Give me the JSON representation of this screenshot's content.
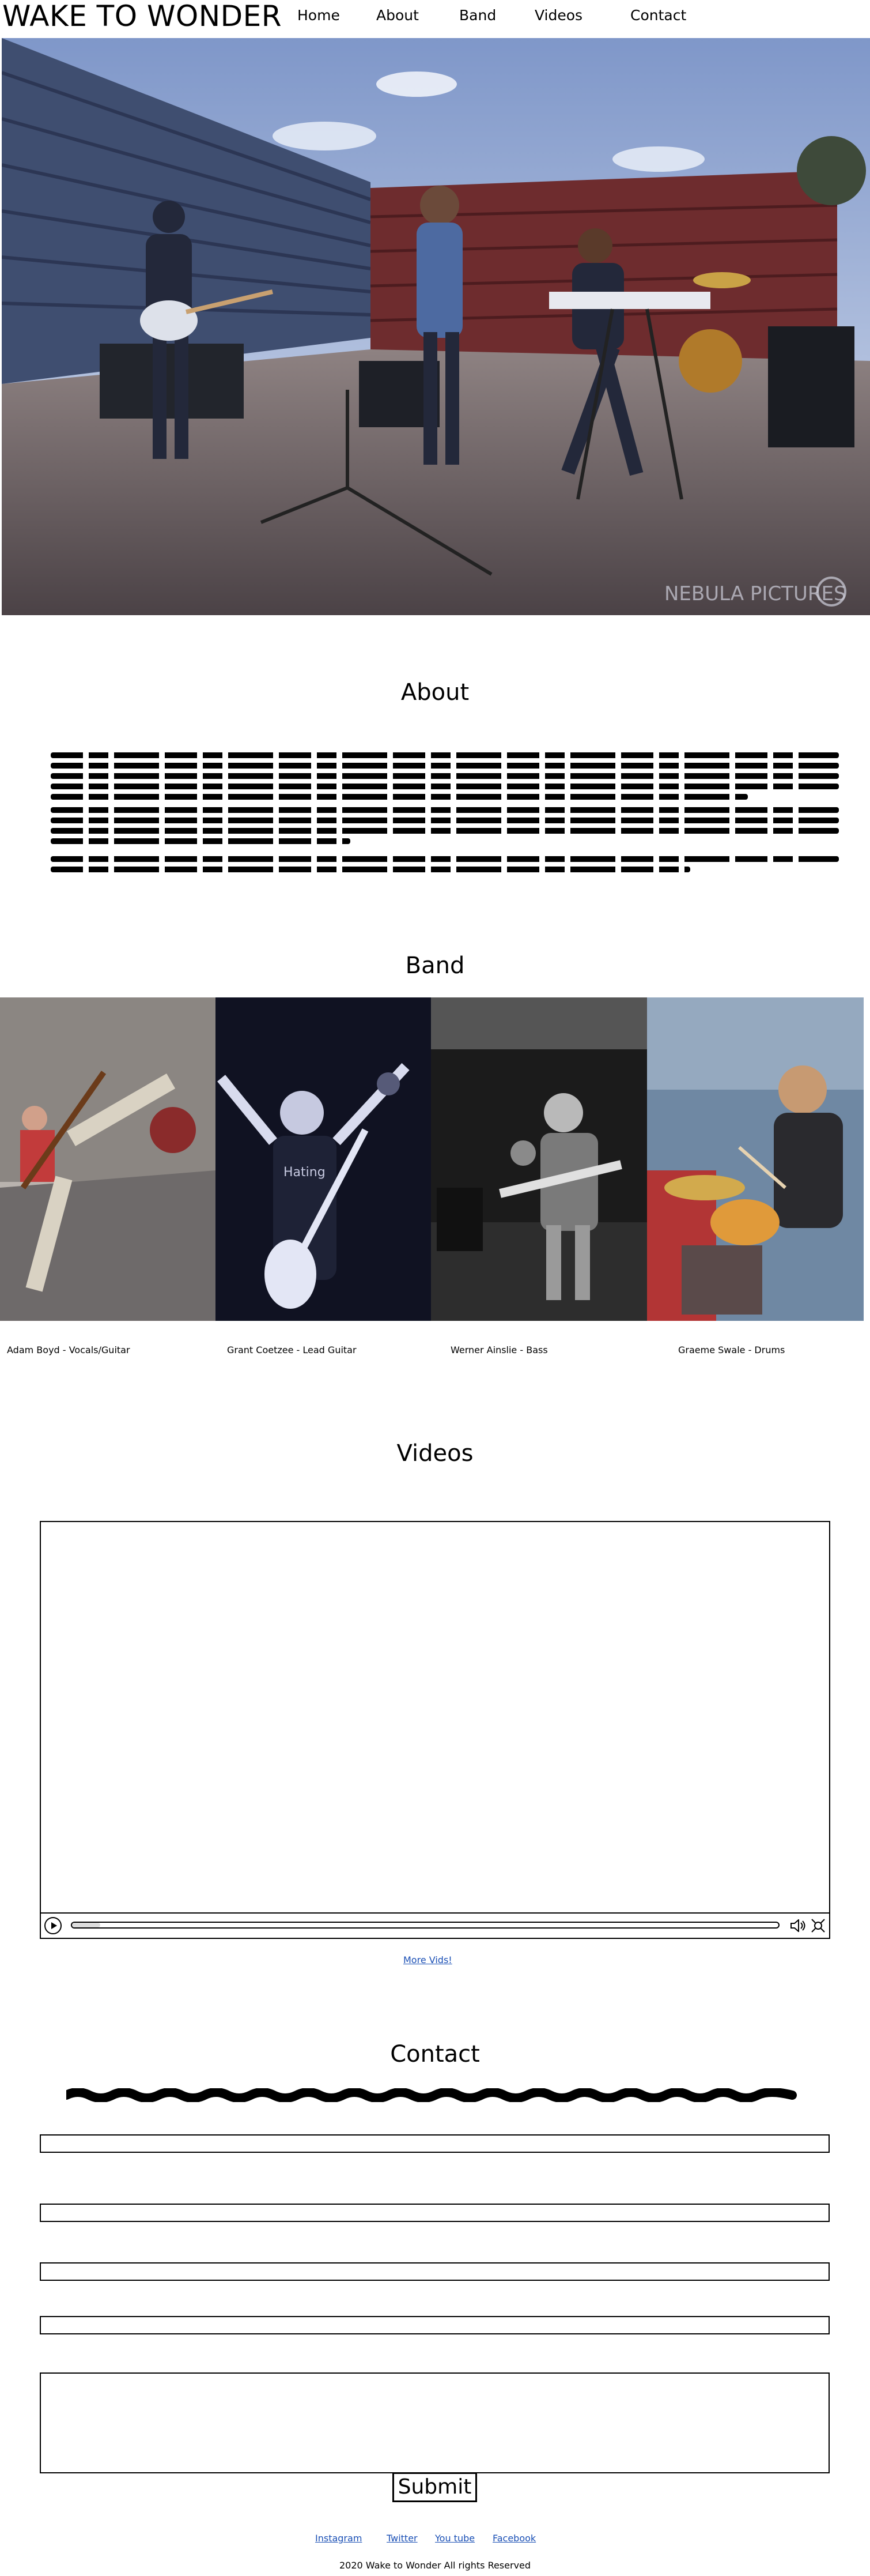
{
  "site": {
    "logo": "WAKE TO WONDER"
  },
  "nav": {
    "items": [
      {
        "label": "Home"
      },
      {
        "label": "About"
      },
      {
        "label": "Band"
      },
      {
        "label": "Videos"
      },
      {
        "label": "Contact"
      }
    ]
  },
  "hero": {
    "watermark": "NEBULA PICTURES"
  },
  "about": {
    "title": "About"
  },
  "band": {
    "title": "Band",
    "members": [
      {
        "caption": "Adam Boyd - Vocals/Guitar"
      },
      {
        "caption": "Grant Coetzee - Lead Guitar"
      },
      {
        "caption": "Werner Ainslie - Bass"
      },
      {
        "caption": "Graeme Swale - Drums"
      }
    ]
  },
  "videos": {
    "title": "Videos",
    "more_link": "More Vids!",
    "progress": 0.04
  },
  "contact": {
    "title": "Contact",
    "submit_label": "Submit"
  },
  "social": {
    "links": [
      {
        "label": "Instagram"
      },
      {
        "label": "Twitter"
      },
      {
        "label": "You tube"
      },
      {
        "label": "Facebook"
      }
    ]
  },
  "footer": {
    "copyright": "2020 Wake to Wonder All rights Reserved"
  },
  "colors": {
    "link": "#1a4fb5",
    "text": "#000000",
    "background": "#ffffff"
  }
}
